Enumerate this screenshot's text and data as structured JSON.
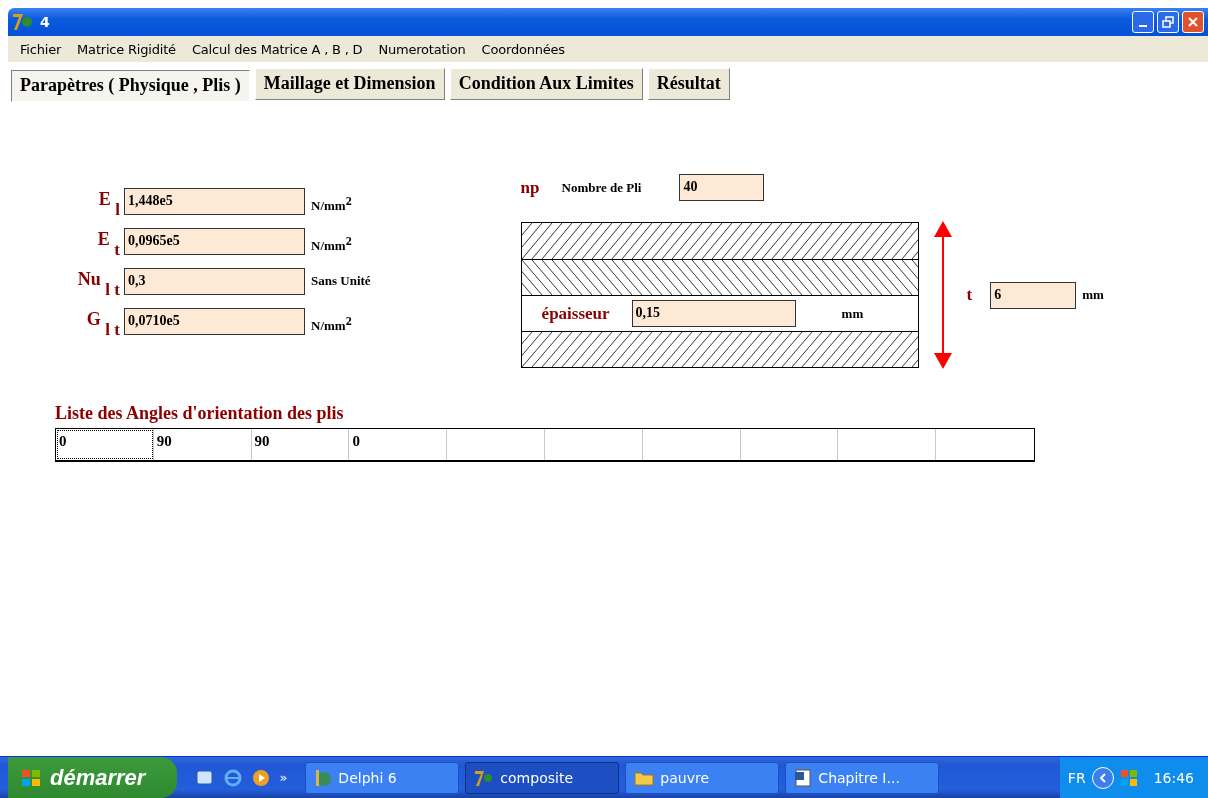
{
  "window": {
    "title": "4"
  },
  "menu": [
    "Fichier",
    "Matrice Rigidité",
    "Calcul des Matrice A , B , D",
    "Numerotation",
    "Coordonnées"
  ],
  "tabs": [
    {
      "label": "Parapètres ( Physique , Plis )",
      "selected": true
    },
    {
      "label": "Maillage et Dimension",
      "selected": false
    },
    {
      "label": "Condition Aux Limites",
      "selected": false
    },
    {
      "label": "Résultat",
      "selected": false
    }
  ],
  "properties": [
    {
      "label": "E $_{l}$",
      "value": "1,448e5",
      "unit": "N/mm$^{2}$"
    },
    {
      "label": "E $_{t}$",
      "value": "0,0965e5",
      "unit": "N/mm$^{2}$"
    },
    {
      "label": "Nu $_{l t}$",
      "value": "0,3",
      "unit": "Sans Unité"
    },
    {
      "label": "G $_{l t}$",
      "value": "0,0710e5",
      "unit": "N/mm$^{2}$"
    }
  ],
  "plies": {
    "symbol": "np",
    "label": "Nombre de Pli",
    "value": "40"
  },
  "layers": [
    {
      "kind": "hatch-right"
    },
    {
      "kind": "hatch-left"
    },
    {
      "kind": "field",
      "label": "épaisseur",
      "value": "0,15",
      "unit": "mm"
    },
    {
      "kind": "hatch-right"
    }
  ],
  "thickness": {
    "symbol": "t",
    "value": "6",
    "unit": "mm"
  },
  "angles": {
    "title": "Liste des Angles d'orientation des plis",
    "values": [
      "0",
      "90",
      "90",
      "0"
    ]
  },
  "taskbar": {
    "start": "démarrer",
    "more": "»",
    "tasks": [
      {
        "label": "Delphi 6",
        "kind": "ide",
        "selected": false
      },
      {
        "label": "composite",
        "kind": "app",
        "selected": true
      },
      {
        "label": "pauvre",
        "kind": "folder",
        "selected": false
      },
      {
        "label": "Chapitre I...",
        "kind": "document",
        "selected": false
      }
    ],
    "language": "FR",
    "clock": "16:46"
  }
}
